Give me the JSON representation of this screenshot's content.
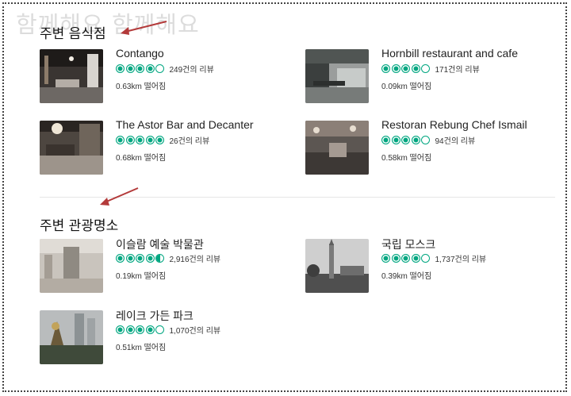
{
  "watermark": "함께해요 함께해요",
  "restaurants": {
    "title": "주변 음식점",
    "items": [
      {
        "name": "Contango",
        "rating": 4.0,
        "reviews": "249건의 리뷰",
        "distance": "0.63km 떨어짐",
        "image": "restaurant-interior-photo"
      },
      {
        "name": "Hornbill restaurant and cafe",
        "rating": 4.0,
        "reviews": "171건의 리뷰",
        "distance": "0.09km 떨어짐",
        "image": "outdoor-cafe-photo"
      },
      {
        "name": "The Astor Bar and Decanter",
        "rating": 5.0,
        "reviews": "26건의 리뷰",
        "distance": "0.68km 떨어짐",
        "image": "bar-interior-photo"
      },
      {
        "name": "Restoran Rebung Chef Ismail",
        "rating": 4.0,
        "reviews": "94건의 리뷰",
        "distance": "0.58km 떨어짐",
        "image": "dining-hall-photo"
      }
    ]
  },
  "attractions": {
    "title": "주변 관광명소",
    "items": [
      {
        "name": "이슬람 예술 박물관",
        "rating": 4.5,
        "reviews": "2,916건의 리뷰",
        "distance": "0.19km 떨어짐",
        "image": "museum-exhibit-photo"
      },
      {
        "name": "국립 모스크",
        "rating": 4.0,
        "reviews": "1,737건의 리뷰",
        "distance": "0.39km 떨어짐",
        "image": "mosque-minaret-photo"
      },
      {
        "name": "레이크 가든 파크",
        "rating": 4.0,
        "reviews": "1,070건의 리뷰",
        "distance": "0.51km 떨어짐",
        "image": "park-sculpture-photo"
      }
    ]
  },
  "colors": {
    "rating_bubble": "#00a680",
    "arrow": "#b33a3a"
  }
}
